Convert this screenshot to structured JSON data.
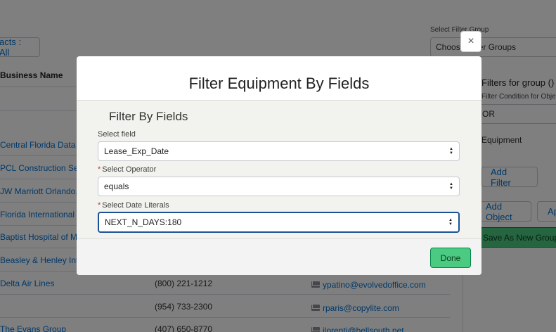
{
  "background": {
    "contacts_button": "acts : All",
    "business_name_header": "Business Name",
    "rows": [
      {
        "name": "Central Florida Data S",
        "phone": "",
        "email": ""
      },
      {
        "name": "PCL Construction Serv",
        "phone": "",
        "email": ""
      },
      {
        "name": "JW Marriott Orlando,",
        "phone": "",
        "email": ""
      },
      {
        "name": "Florida International U",
        "phone": "",
        "email": ""
      },
      {
        "name": "Baptist Hospital of Mi",
        "phone": "",
        "email": ""
      },
      {
        "name": "Beasley & Henley Inte",
        "phone": "",
        "email": ""
      },
      {
        "name": "Delta Air Lines",
        "phone": "(800) 221-1212",
        "email": "ypatino@evolvedoffice.com"
      },
      {
        "name": "",
        "phone": "(954) 733-2300",
        "email": "rparis@copylite.com"
      },
      {
        "name": "The Evans Group",
        "phone": "(407) 650-8770",
        "email": "jlorenti@bellsouth.net"
      }
    ],
    "right_panel": {
      "select_filter_group_label": "Select Filter Group",
      "choose_groups_value": "Choose Filter Groups",
      "filters_for_group": "Filters for group ()",
      "filter_condition_label": "Filter Condition for Object",
      "condition_value": "OR",
      "equipment_label": "Equipment",
      "add_filter_button": "Add Filter",
      "add_object_button": "Add Object",
      "apply_button": "Apply",
      "save_group_button": "Save As New Group"
    }
  },
  "modal": {
    "title": "Filter Equipment By Fields",
    "section_title": "Filter By Fields",
    "select_field_label": "Select field",
    "select_field_value": "Lease_Exp_Date",
    "operator_label": "Select Operator",
    "operator_value": "equals",
    "date_literals_label": "Select Date Literals",
    "date_literals_value": "NEXT_N_DAYS:180",
    "required_marker": "*",
    "done_button": "Done",
    "close_glyph": "×"
  }
}
